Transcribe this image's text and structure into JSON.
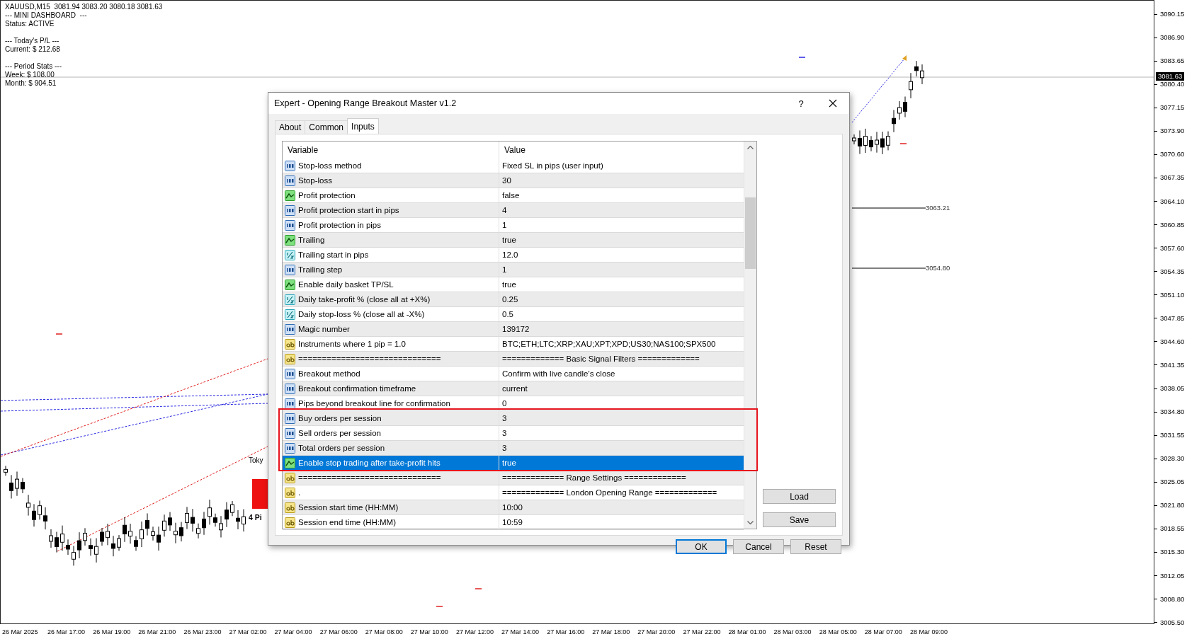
{
  "chart": {
    "info_panel": [
      [
        "XAUUSD,M15  3081.94 3083.20 3080.18 3081.63",
        "--- MINI DASHBOARD  ---",
        "Status: ACTIVE"
      ],
      [
        "--- Today's P/L ---",
        "Current: $ 212.68"
      ],
      [
        "--- Period Stats ---",
        "Week: $ 108.00",
        "Month: $ 904.51"
      ]
    ],
    "level_labels": [
      "3063.21",
      "3054.80"
    ],
    "session_labels": [
      {
        "kind": "name",
        "text": "Toky"
      },
      {
        "kind": "range",
        "text": "4 Pi"
      }
    ],
    "price_axis": {
      "labels": [
        "3090.15",
        "3086.90",
        "3083.65",
        "3080.40",
        "3077.15",
        "3073.90",
        "3070.60",
        "3067.35",
        "3064.10",
        "3060.85",
        "3057.60",
        "3054.35",
        "3051.10",
        "3047.85",
        "3044.60",
        "3041.35",
        "3038.05",
        "3034.80",
        "3031.55",
        "3028.30",
        "3025.05",
        "3021.80",
        "3018.55",
        "3015.30",
        "3012.05",
        "3008.80",
        "3005.50"
      ],
      "current_price": "3081.63"
    },
    "time_axis": {
      "labels": [
        "26 Mar 2025",
        "26 Mar 17:00",
        "26 Mar 19:00",
        "26 Mar 21:00",
        "26 Mar 23:00",
        "27 Mar 02:00",
        "27 Mar 04:00",
        "27 Mar 06:00",
        "27 Mar 08:00",
        "27 Mar 10:00",
        "27 Mar 12:00",
        "27 Mar 14:00",
        "27 Mar 16:00",
        "27 Mar 18:00",
        "27 Mar 20:00",
        "27 Mar 22:00",
        "28 Mar 01:00",
        "28 Mar 03:00",
        "28 Mar 05:00",
        "28 Mar 07:00",
        "28 Mar 09:00"
      ]
    }
  },
  "dialog": {
    "title": "Expert - Opening Range Breakout Master v1.2",
    "help": "?",
    "tabs": [
      {
        "label": "About",
        "selected": false
      },
      {
        "label": "Common",
        "selected": false
      },
      {
        "label": "Inputs",
        "selected": true
      }
    ],
    "table": {
      "columns": [
        "Variable",
        "Value"
      ],
      "rows": [
        {
          "kind": "int",
          "variable": "Stop-loss method",
          "value": "Fixed SL in pips (user input)",
          "selected": false,
          "highlighted": false
        },
        {
          "kind": "int",
          "variable": "Stop-loss",
          "value": "30",
          "selected": false,
          "highlighted": false
        },
        {
          "kind": "bool",
          "variable": "Profit protection",
          "value": "false",
          "selected": false,
          "highlighted": false
        },
        {
          "kind": "int",
          "variable": "Profit protection start in pips",
          "value": "4",
          "selected": false,
          "highlighted": false
        },
        {
          "kind": "int",
          "variable": "Profit protection in pips",
          "value": "1",
          "selected": false,
          "highlighted": false
        },
        {
          "kind": "bool",
          "variable": "Trailing",
          "value": "true",
          "selected": false,
          "highlighted": false
        },
        {
          "kind": "double",
          "variable": "Trailing start in pips",
          "value": "12.0",
          "selected": false,
          "highlighted": false
        },
        {
          "kind": "int",
          "variable": "Trailing step",
          "value": "1",
          "selected": false,
          "highlighted": false
        },
        {
          "kind": "bool",
          "variable": "Enable daily basket TP/SL",
          "value": "true",
          "selected": false,
          "highlighted": false
        },
        {
          "kind": "double",
          "variable": "Daily take-profit % (close all at +X%)",
          "value": "0.25",
          "selected": false,
          "highlighted": false
        },
        {
          "kind": "double",
          "variable": "Daily stop-loss % (close all at -X%)",
          "value": "0.5",
          "selected": false,
          "highlighted": false
        },
        {
          "kind": "int",
          "variable": "Magic number",
          "value": "139172",
          "selected": false,
          "highlighted": false
        },
        {
          "kind": "string",
          "variable": "Instruments where 1 pip = 1.0",
          "value": "BTC;ETH;LTC;XRP;XAU;XPT;XPD;US30;NAS100;SPX500",
          "selected": false,
          "highlighted": false
        },
        {
          "kind": "string",
          "variable": "==============================",
          "value": "============= Basic Signal Filters =============",
          "selected": false,
          "highlighted": false
        },
        {
          "kind": "int",
          "variable": "Breakout method",
          "value": "Confirm with live candle's close",
          "selected": false,
          "highlighted": false
        },
        {
          "kind": "int",
          "variable": "Breakout confirmation timeframe",
          "value": "current",
          "selected": false,
          "highlighted": false
        },
        {
          "kind": "int",
          "variable": "Pips beyond breakout line for confirmation",
          "value": "0",
          "selected": false,
          "highlighted": false
        },
        {
          "kind": "int",
          "variable": "Buy orders per session",
          "value": "3",
          "selected": false,
          "highlighted": true
        },
        {
          "kind": "int",
          "variable": "Sell orders per session",
          "value": "3",
          "selected": false,
          "highlighted": true
        },
        {
          "kind": "int",
          "variable": "Total orders per session",
          "value": "3",
          "selected": false,
          "highlighted": true
        },
        {
          "kind": "bool",
          "variable": "Enable stop trading after take-profit hits",
          "value": "true",
          "selected": true,
          "highlighted": true
        },
        {
          "kind": "string",
          "variable": "==============================",
          "value": "============= Range Settings =============",
          "selected": false,
          "highlighted": false
        },
        {
          "kind": "string",
          "variable": ".",
          "value": "============= London Opening Range =============",
          "selected": false,
          "highlighted": false
        },
        {
          "kind": "string",
          "variable": "Session start time (HH:MM)",
          "value": "10:00",
          "selected": false,
          "highlighted": false
        },
        {
          "kind": "string",
          "variable": "Session end time (HH:MM)",
          "value": "10:59",
          "selected": false,
          "highlighted": false
        }
      ]
    },
    "side_buttons": [
      "Load",
      "Save"
    ],
    "buttons": [
      {
        "label": "OK",
        "default": true
      },
      {
        "label": "Cancel",
        "default": false
      },
      {
        "label": "Reset",
        "default": false
      }
    ]
  }
}
